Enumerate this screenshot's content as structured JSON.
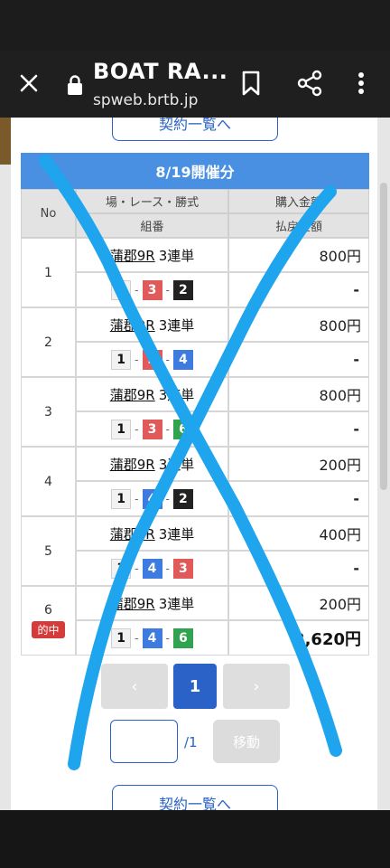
{
  "browser": {
    "title": "BOAT RA...",
    "url": "spweb.brtb.jp"
  },
  "page": {
    "link_top": "契約一覧へ",
    "link_bottom": "契約一覧へ",
    "table_title": "8/19開催分",
    "headers": {
      "no": "No",
      "race": "場・レース・勝式",
      "combo": "組番",
      "purchase": "購入金額",
      "payout": "払戻金額"
    },
    "rows": [
      {
        "no": "1",
        "venue": "蒲郡9R",
        "bet_type": "3連単",
        "combo": [
          "1",
          "3",
          "2"
        ],
        "purchase": "800円",
        "payout": "-",
        "hit": ""
      },
      {
        "no": "2",
        "venue": "蒲郡9R",
        "bet_type": "3連単",
        "combo": [
          "1",
          "3",
          "4"
        ],
        "purchase": "800円",
        "payout": "-",
        "hit": ""
      },
      {
        "no": "3",
        "venue": "蒲郡9R",
        "bet_type": "3連単",
        "combo": [
          "1",
          "3",
          "6"
        ],
        "purchase": "800円",
        "payout": "-",
        "hit": ""
      },
      {
        "no": "4",
        "venue": "蒲郡9R",
        "bet_type": "3連単",
        "combo": [
          "1",
          "4",
          "2"
        ],
        "purchase": "200円",
        "payout": "-",
        "hit": ""
      },
      {
        "no": "5",
        "venue": "蒲郡9R",
        "bet_type": "3連単",
        "combo": [
          "1",
          "4",
          "3"
        ],
        "purchase": "400円",
        "payout": "-",
        "hit": ""
      },
      {
        "no": "6",
        "venue": "蒲郡9R",
        "bet_type": "3連単",
        "combo": [
          "1",
          "4",
          "6"
        ],
        "purchase": "200円",
        "payout": "3,620円",
        "hit": "的中"
      }
    ],
    "pager": {
      "prev": "‹",
      "current": "1",
      "next": "›",
      "input_value": "",
      "total": "/1",
      "move": "移動"
    }
  },
  "colors": {
    "accent": "#2a62c8",
    "table_title_bg": "#4a90e2",
    "hit_badge": "#d63b3b",
    "scribble": "#1ea5ee"
  }
}
